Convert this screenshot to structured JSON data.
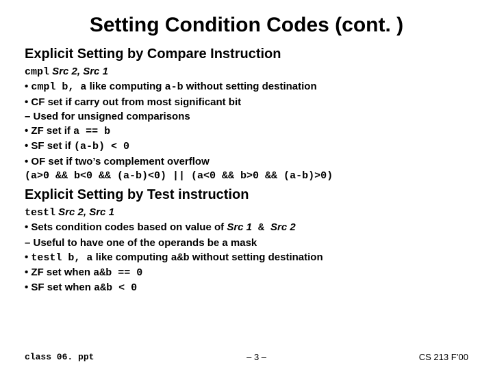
{
  "title": "Setting Condition Codes (cont. )",
  "section1": {
    "heading": "Explicit Setting by Compare Instruction",
    "line_instr_m": "cmpl",
    "line_instr_args": " Src 2, Src 1",
    "b1_pre": "•  ",
    "b1_m": "cmpl b, a",
    "b1_mid": " like computing ",
    "b1_m2": "a-b",
    "b1_post": " without setting destination",
    "b2": "•  CF set if carry out from most significant bit",
    "b2s": "– Used for unsigned comparisons",
    "b3_pre": "•  ZF set if ",
    "b3_m": "a == b",
    "b4_pre": "•  SF set if ",
    "b4_m": "(a-b) < 0",
    "b5": "•  OF set if two’s complement overflow",
    "b5_m": "(a>0 && b<0 && (a-b)<0) || (a<0 && b>0 && (a-b)>0)"
  },
  "section2": {
    "heading": "Explicit Setting by Test instruction",
    "line_instr_m": "testl",
    "line_instr_args": " Src 2, Src 1",
    "b1_pre": "•  Sets condition codes based on value of ",
    "b1_i1": "Src 1",
    "b1_amp": " & ",
    "b1_i2": "Src 2",
    "b1s": "– Useful to have one of the operands be a mask",
    "b2_pre": "•  ",
    "b2_m": "testl b, a",
    "b2_mid": " like computing  ",
    "b2_m2": "a&b",
    "b2_post": " without setting destination",
    "b3_pre": "•  ZF set when ",
    "b3_m": "a&b == 0",
    "b4_pre": "•  SF set when ",
    "b4_m": "a&b < 0"
  },
  "footer": {
    "left": "class 06. ppt",
    "center": "– 3 –",
    "right": "CS 213 F’00"
  }
}
